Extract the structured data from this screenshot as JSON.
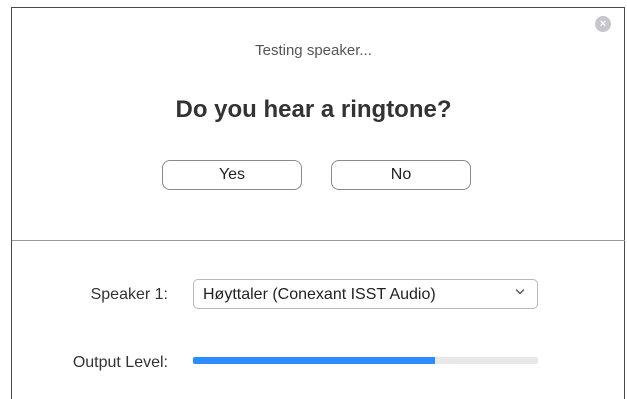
{
  "dialog": {
    "status_text": "Testing speaker...",
    "question": "Do you hear a ringtone?",
    "yes_label": "Yes",
    "no_label": "No",
    "close_symbol": "×"
  },
  "speaker": {
    "label": "Speaker 1:",
    "selected": "Høyttaler (Conexant ISST Audio)",
    "chevron_icon": "chevron-down-icon"
  },
  "output": {
    "label": "Output Level:",
    "level_fraction": 0.7
  },
  "colors": {
    "accent": "#2d8cff",
    "close_button": "#c6c6cc"
  }
}
